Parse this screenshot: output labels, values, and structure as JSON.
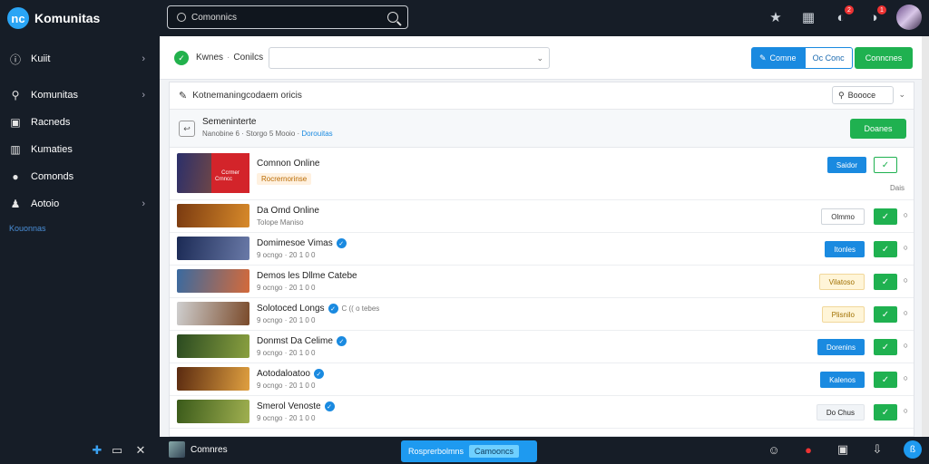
{
  "app": {
    "title": "Komunitas",
    "logo_glyph": "nc"
  },
  "search": {
    "placeholder": "Comonnics"
  },
  "topbar": {
    "badges": [
      "2",
      "1"
    ]
  },
  "sidebar": {
    "items": [
      {
        "label": "Kuiit",
        "icon": "info-icon",
        "chevron": true
      },
      {
        "label": "Komunitas",
        "icon": "search-icon",
        "chevron": true
      },
      {
        "label": "Racneds",
        "icon": "briefcase-icon",
        "chevron": false
      },
      {
        "label": "Kumaties",
        "icon": "building-icon",
        "chevron": false
      },
      {
        "label": "Comonds",
        "icon": "user-icon",
        "chevron": false
      },
      {
        "label": "Aotoio",
        "icon": "person-icon",
        "chevron": true
      }
    ],
    "active_label": "Kouonnas"
  },
  "toolbar": {
    "breadcrumb": [
      "Kwnes",
      "Conilcs"
    ],
    "segment": [
      "Comne",
      "Oc Conc"
    ],
    "green_button": "Conncnes"
  },
  "panel": {
    "header": "Kotnemaningcodaem oricis",
    "sort_label": "Boooce",
    "subheader": {
      "title": "Semeninterte",
      "meta": "Nanobine 6 · Storgo 5 Mooio ·",
      "link": "Dorouitas",
      "button": "Doanes"
    }
  },
  "games": [
    {
      "name": "Comnon Online",
      "meta": "Rocrernorinse",
      "status": "Saidor",
      "status_style": "blue",
      "check_outline": true,
      "verified": false,
      "extra": "Dais",
      "thumb": [
        "#2b2f6a",
        "#a85a2a"
      ],
      "tag": [
        "Ccrmer",
        "Crnncc"
      ]
    },
    {
      "name": "Da Omd Online",
      "meta": "Tolope Maniso",
      "status": "Olmmo",
      "status_style": "outline",
      "check_outline": false,
      "verified": false,
      "thumb": [
        "#7a3a10",
        "#d88a2a"
      ]
    },
    {
      "name": "Domimesoe Vimas",
      "meta": "9 ocngo · 20 1 0 0",
      "status": "Itonles",
      "status_style": "blue",
      "check_outline": false,
      "verified": true,
      "thumb": [
        "#1b2a55",
        "#6a7aa8"
      ]
    },
    {
      "name": "Demos les Dllme Catebe",
      "meta": "9 ocngo · 20 1 0 0",
      "status": "Vilatoso",
      "status_style": "yellow",
      "check_outline": false,
      "verified": false,
      "thumb": [
        "#3a6aa0",
        "#d46a3a"
      ]
    },
    {
      "name": "Solotoced Longs",
      "meta": "9 ocngo · 20 1 0 0",
      "status": "Plisnilo",
      "status_style": "yellow",
      "check_outline": false,
      "verified": true,
      "suffix": "C (( o tebes",
      "thumb": [
        "#cfcfcf",
        "#7a4a2a"
      ]
    },
    {
      "name": "Donmst Da Celime",
      "meta": "9 ocngo · 20 1 0 0",
      "status": "Dorenins",
      "status_style": "blue",
      "check_outline": false,
      "verified": true,
      "thumb": [
        "#2a4a20",
        "#8aa040"
      ]
    },
    {
      "name": "Aotodaloatoo",
      "meta": "9 ocngo · 20 1 0 0",
      "status": "Kalenos",
      "status_style": "blue",
      "check_outline": false,
      "verified": true,
      "thumb": [
        "#5a2a10",
        "#e0a040"
      ]
    },
    {
      "name": "Smerol Venoste",
      "meta": "9 ocngo · 20 1 0 0",
      "status": "Do Chus",
      "status_style": "light",
      "check_outline": false,
      "verified": true,
      "thumb": [
        "#3a5a1a",
        "#a0b050"
      ]
    }
  ],
  "bottombar": {
    "label": "Comnres",
    "cta": "Rosprerbolmns",
    "cta_pill": "Camooncs"
  },
  "colors": {
    "accent": "#1a8ae0",
    "green": "#1fb150",
    "dark": "#161d27"
  }
}
